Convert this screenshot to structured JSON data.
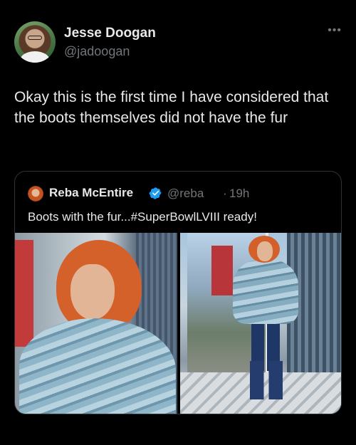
{
  "author": {
    "display_name": "Jesse Doogan",
    "handle": "@jadoogan",
    "avatar_icon": "user-avatar",
    "more_icon": "more-horizontal-icon"
  },
  "tweet": {
    "text": "Okay this is the first time I have considered that the boots themselves did not have the fur"
  },
  "quote": {
    "display_name": "Reba McEntire",
    "verified_icon": "verified-badge-icon",
    "verified_color": "#1d9bf0",
    "handle": "@reba",
    "separator": "·",
    "time": "19h",
    "text": "Boots with the fur...#SuperBowlLVIII  ready!"
  },
  "colors": {
    "background": "#000000",
    "primary_text": "#e7e9ea",
    "secondary_text": "#71767b",
    "border": "#2f3336"
  }
}
